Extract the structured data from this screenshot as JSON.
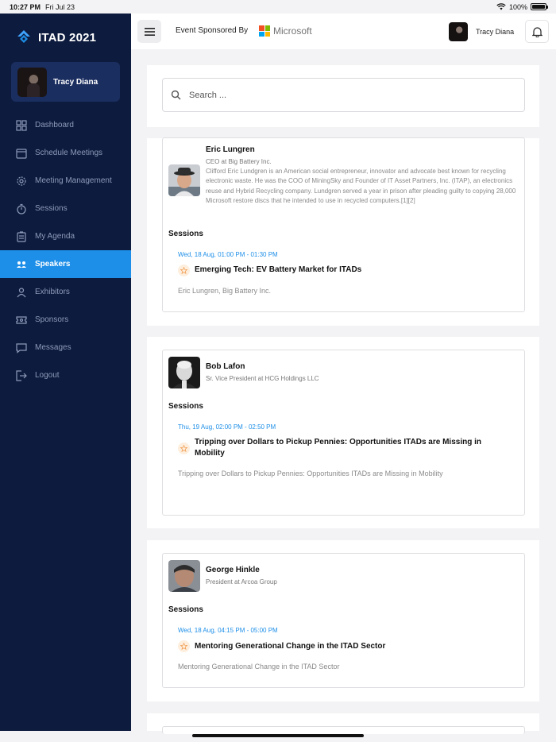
{
  "status_bar": {
    "time": "10:27 PM",
    "date": "Fri Jul 23",
    "battery": "100%",
    "battery_level": 1.0
  },
  "brand": {
    "title": "ITAD 2021"
  },
  "user": {
    "name": "Tracy Diana"
  },
  "nav": {
    "items": [
      {
        "label": "Dashboard",
        "icon": "grid-icon"
      },
      {
        "label": "Schedule Meetings",
        "icon": "calendar-icon"
      },
      {
        "label": "Meeting Management",
        "icon": "gear-icon"
      },
      {
        "label": "Sessions",
        "icon": "stopwatch-icon"
      },
      {
        "label": "My Agenda",
        "icon": "clipboard-icon"
      },
      {
        "label": "Speakers",
        "icon": "speakers-icon",
        "active": true
      },
      {
        "label": "Exhibitors",
        "icon": "person-icon"
      },
      {
        "label": "Sponsors",
        "icon": "ticket-icon"
      },
      {
        "label": "Messages",
        "icon": "chat-icon"
      },
      {
        "label": "Logout",
        "icon": "logout-icon"
      }
    ]
  },
  "header": {
    "sponsor_text": "Event Sponsored By",
    "sponsor_name": "Microsoft"
  },
  "search": {
    "placeholder": "Search ..."
  },
  "colors": {
    "sidebar": "#0d1b3e",
    "accent": "#1e8fe8",
    "profile_card": "#1b2e60"
  },
  "speakers": [
    {
      "name": "Eric Lungren",
      "role": "CEO at Big Battery Inc.",
      "bio": "Clifford Eric Lundgren is an American social entrepreneur, innovator and advocate best known for recycling electronic waste. He was the COO of MiningSky and Founder of IT Asset Partners, Inc. (ITAP), an electronics reuse and Hybrid Recycling company. Lundgren served a year in prison after pleading guilty to copying 28,000 Microsoft restore discs that he intended to use in recycled computers.[1][2]",
      "sessions_label": "Sessions",
      "session": {
        "time": "Wed, 18 Aug, 01:00 PM - 01:30 PM",
        "title": "Emerging Tech: EV Battery Market for ITADs",
        "speakers": "Eric Lungren, Big Battery Inc."
      }
    },
    {
      "name": "Bob Lafon",
      "role": "Sr. Vice President at HCG Holdings LLC",
      "bio": "",
      "sessions_label": "Sessions",
      "session": {
        "time": "Thu, 19 Aug, 02:00 PM - 02:50 PM",
        "title": "Tripping over Dollars to Pickup Pennies: Opportunities ITADs are Missing in Mobility",
        "speakers": "Tripping over Dollars to Pickup Pennies: Opportunities ITADs are Missing in Mobility"
      }
    },
    {
      "name": "George Hinkle",
      "role": "President at Arcoa Group",
      "bio": "",
      "sessions_label": "Sessions",
      "session": {
        "time": "Wed, 18 Aug, 04:15 PM - 05:00 PM",
        "title": "Mentoring Generational Change in the ITAD Sector",
        "speakers": "Mentoring Generational Change in the ITAD Sector"
      }
    }
  ]
}
